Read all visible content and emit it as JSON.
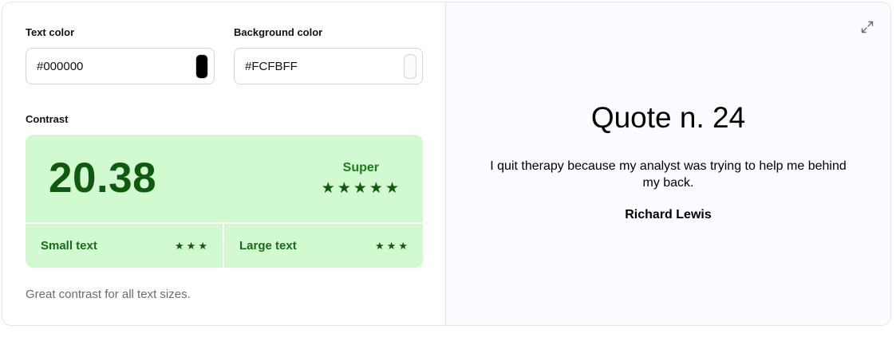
{
  "text_color": {
    "label": "Text color",
    "value": "#000000",
    "swatch": "#000000"
  },
  "background_color": {
    "label": "Background color",
    "value": "#FCFBFF",
    "swatch": "#FCFBFF"
  },
  "contrast": {
    "label": "Contrast",
    "ratio": "20.38",
    "rating": "Super",
    "rating_stars": 5,
    "small_text": {
      "label": "Small text",
      "stars": 3
    },
    "large_text": {
      "label": "Large text",
      "stars": 3
    },
    "colors": {
      "panel": "#D2FAD0",
      "value": "#0F5A0F",
      "label": "#1B7A1B"
    }
  },
  "footnote": "Great contrast for all text sizes.",
  "preview": {
    "title": "Quote n. 24",
    "quote": "I quit therapy because my analyst was trying to help me behind my back.",
    "author": "Richard Lewis",
    "expand_icon": "expand-icon"
  }
}
